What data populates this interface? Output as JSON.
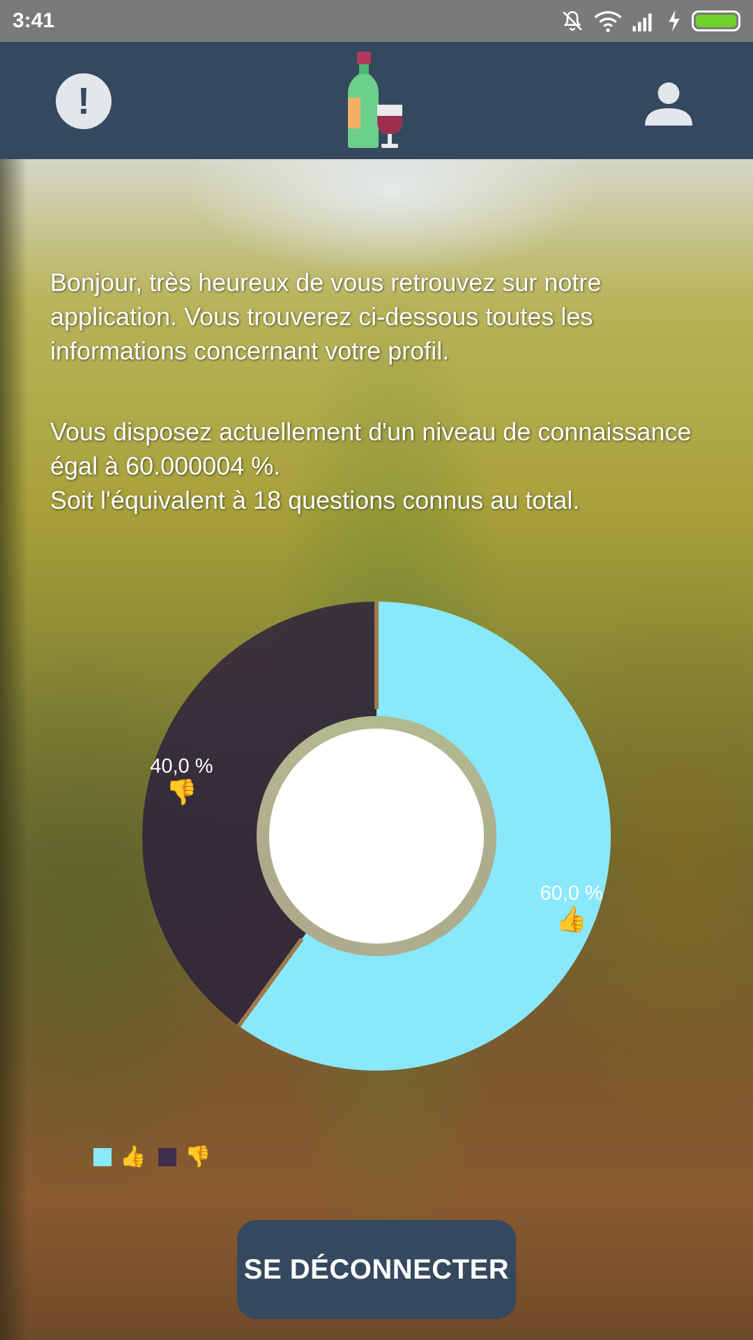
{
  "status_bar": {
    "time": "3:41",
    "icons": [
      "bell-off-icon",
      "wifi-icon",
      "signal-icon",
      "charging-icon",
      "battery-icon"
    ],
    "battery_color": "#6fd12a"
  },
  "app_bar": {
    "background": "#34495e",
    "left_icon": "alert-icon",
    "left_icon_glyph": "!",
    "logo": "wine-bottle-glass-logo",
    "right_icon": "user-icon"
  },
  "content": {
    "intro_text": "Bonjour, très heureux de vous retrouvez sur notre application. Vous trouverez ci-dessous toutes les informations concernant votre profil.",
    "level_text": "Vous disposez actuellement d'un niveau de connaissance égal à 60.000004 %.\n Soit l'équivalent à 18 questions connus au total."
  },
  "chart_data": {
    "type": "pie",
    "subtype": "donut",
    "categories": [
      "👍",
      "👎"
    ],
    "values": [
      60.0,
      40.0
    ],
    "labels": [
      "60,0 %",
      "40,0 %"
    ],
    "colors": [
      "#8ae8fc",
      "#3e2e4c"
    ],
    "legend_placement": "bottom-left"
  },
  "legend": {
    "items": [
      {
        "color": "#8ae8fc",
        "emoji": "👍"
      },
      {
        "color": "#3e2e4c",
        "emoji": "👎"
      }
    ]
  },
  "actions": {
    "logout_label": "SE DÉCONNECTER"
  }
}
